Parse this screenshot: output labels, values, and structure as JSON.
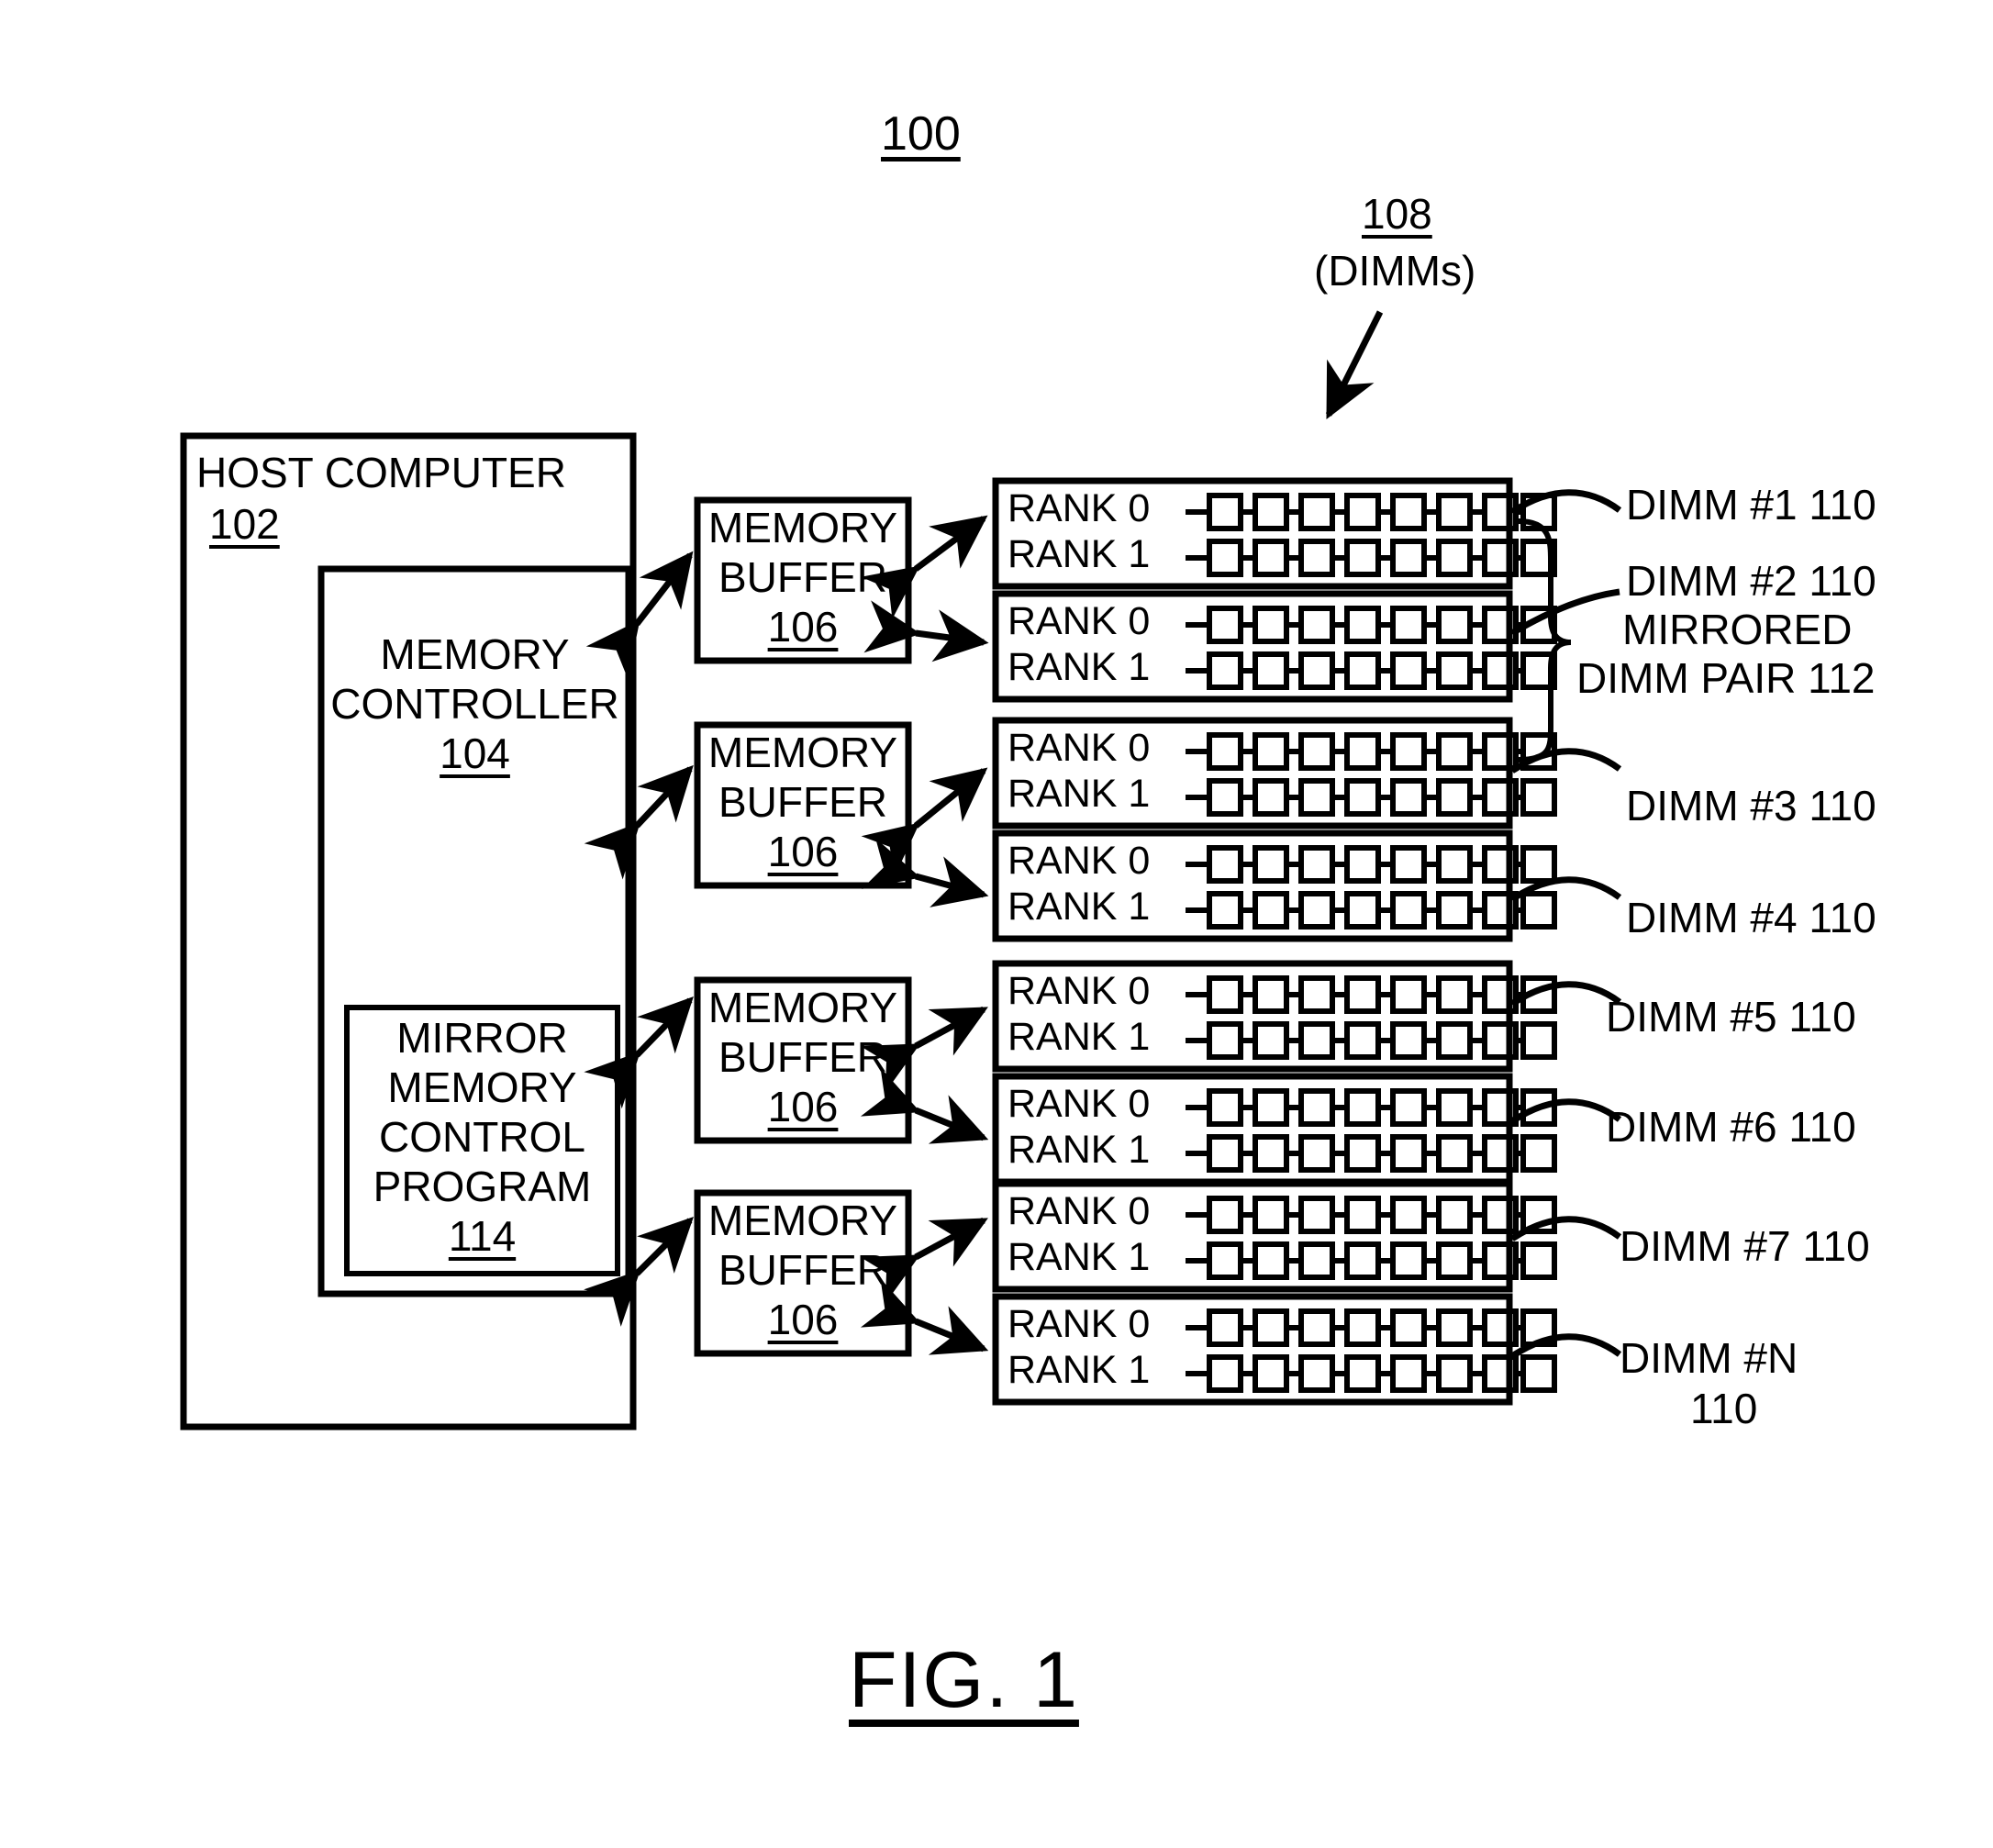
{
  "figure": {
    "system_number": "100",
    "caption": "FIG. 1",
    "dimms_group_number": "108",
    "dimms_group_label": "(DIMMs)"
  },
  "host_computer": {
    "title": "HOST COMPUTER",
    "ref": "102"
  },
  "memory_controller": {
    "line1": "MEMORY",
    "line2": "CONTROLLER",
    "ref": "104"
  },
  "mirror_program": {
    "line1": "MIRROR",
    "line2": "MEMORY",
    "line3": "CONTROL",
    "line4": "PROGRAM",
    "ref": "114"
  },
  "memory_buffers": [
    {
      "line1": "MEMORY",
      "line2": "BUFFER",
      "ref": "106"
    },
    {
      "line1": "MEMORY",
      "line2": "BUFFER",
      "ref": "106"
    },
    {
      "line1": "MEMORY",
      "line2": "BUFFER",
      "ref": "106"
    },
    {
      "line1": "MEMORY",
      "line2": "BUFFER",
      "ref": "106"
    }
  ],
  "rank_labels": {
    "rank0": "RANK 0",
    "rank1": "RANK 1"
  },
  "dimms": [
    {
      "label": "DIMM #1 110",
      "ranks": [
        "RANK 0",
        "RANK 1"
      ],
      "chips_per_rank": 8
    },
    {
      "label": "DIMM #2 110",
      "ranks": [
        "RANK 0",
        "RANK 1"
      ],
      "chips_per_rank": 8
    },
    {
      "label": "DIMM #3 110",
      "ranks": [
        "RANK 0",
        "RANK 1"
      ],
      "chips_per_rank": 8
    },
    {
      "label": "DIMM #4 110",
      "ranks": [
        "RANK 0",
        "RANK 1"
      ],
      "chips_per_rank": 8
    },
    {
      "label": "DIMM #5 110",
      "ranks": [
        "RANK 0",
        "RANK 1"
      ],
      "chips_per_rank": 8
    },
    {
      "label": "DIMM #6 110",
      "ranks": [
        "RANK 0",
        "RANK 1"
      ],
      "chips_per_rank": 8
    },
    {
      "label": "DIMM #7 110",
      "ranks": [
        "RANK 0",
        "RANK 1"
      ],
      "chips_per_rank": 8
    },
    {
      "label": "DIMM #N",
      "label_line2": "110",
      "ranks": [
        "RANK 0",
        "RANK 1"
      ],
      "chips_per_rank": 8
    }
  ],
  "mirrored_pair": {
    "line1": "MIRRORED",
    "line2": "DIMM PAIR 112"
  },
  "colors": {
    "stroke": "#000000",
    "fill": "#ffffff"
  }
}
